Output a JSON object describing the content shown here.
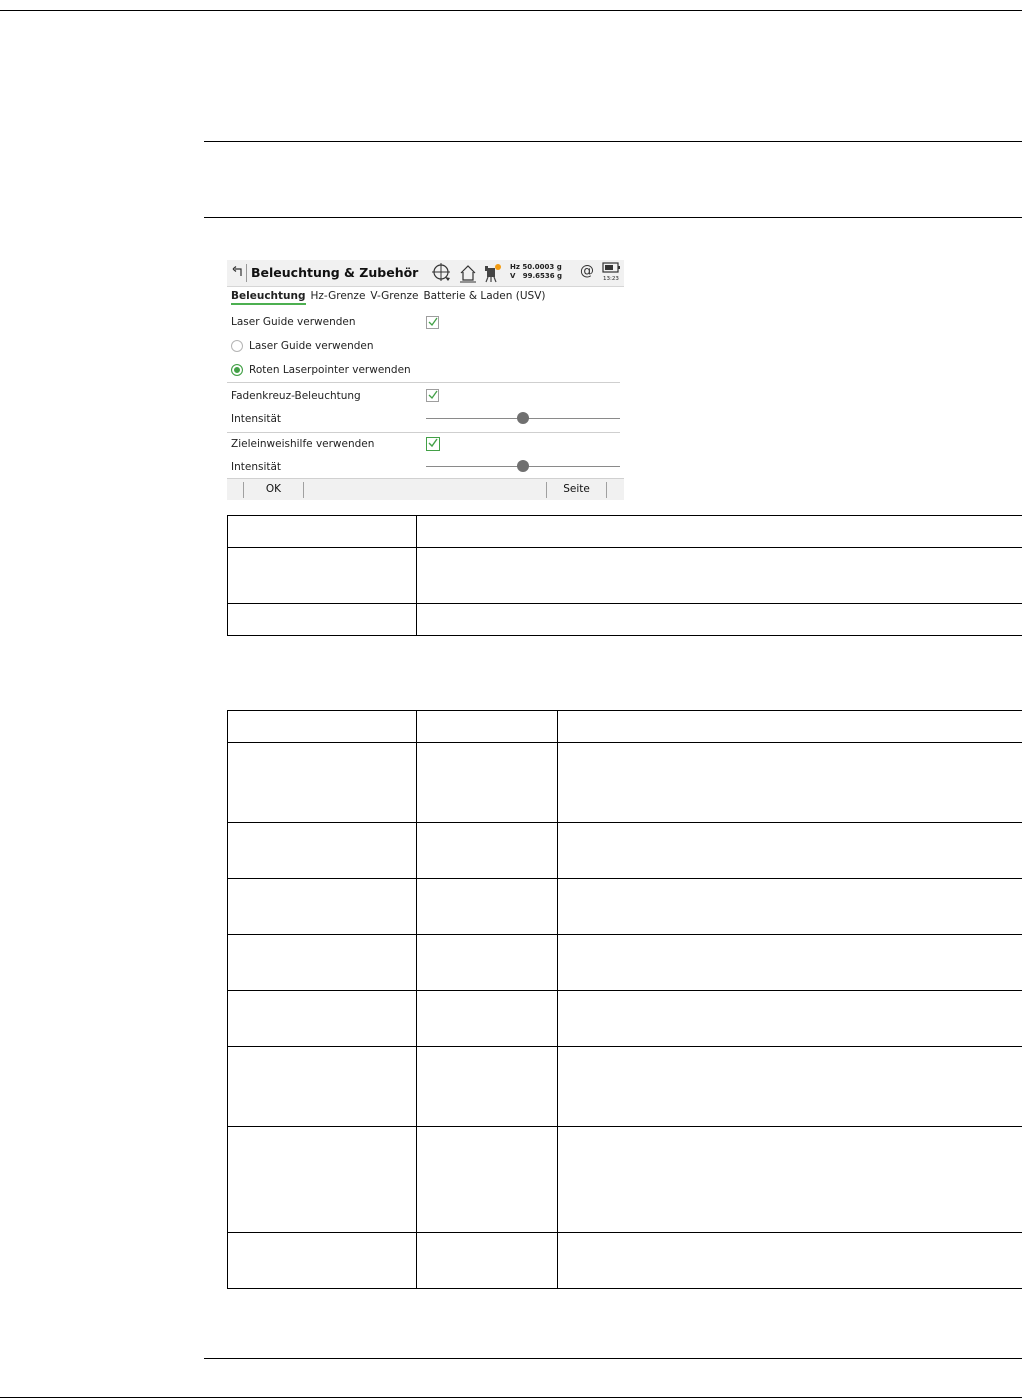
{
  "device": {
    "title": "Beleuchtung & Zubehör",
    "status": {
      "hz": "Hz 50.0003 g",
      "v": "V   99.6536 g",
      "time": "13:23",
      "at_symbol": "@"
    },
    "icons": [
      "back-icon",
      "crosshair-icon",
      "home-icon",
      "instrument-icon",
      "battery-icon"
    ],
    "tabs": [
      {
        "label": "Beleuchtung",
        "active": true
      },
      {
        "label": "Hz-Grenze",
        "active": false
      },
      {
        "label": "V-Grenze",
        "active": false
      },
      {
        "label": "Batterie & Laden (USV)",
        "active": false
      }
    ],
    "laser_guide": {
      "label": "Laser Guide verwenden",
      "checked": true
    },
    "radios": [
      {
        "label": "Laser Guide verwenden",
        "selected": false
      },
      {
        "label": "Roten Laserpointer verwenden",
        "selected": true
      }
    ],
    "crosshair_illumination": {
      "label": "Fadenkreuz-Beleuchtung",
      "checked": true
    },
    "intensity_1": {
      "label": "Intensität",
      "level": 0.5
    },
    "target_aid": {
      "label": "Zieleinweishilfe verwenden",
      "checked": true
    },
    "intensity_2": {
      "label": "Intensität",
      "level": 0.5
    },
    "softkeys": {
      "ok": "OK",
      "page": "Seite"
    }
  },
  "accent_color": "#43a047"
}
